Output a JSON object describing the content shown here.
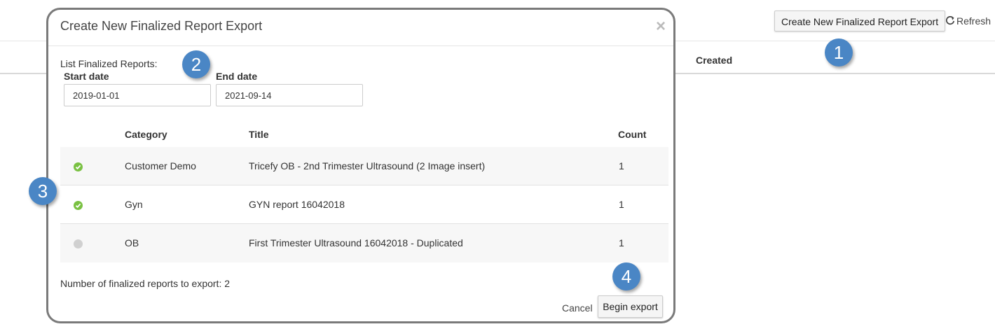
{
  "background": {
    "create_button_label": "Create New Finalized Report Export",
    "refresh_label": "Refresh",
    "created_header": "Created"
  },
  "modal": {
    "title": "Create New Finalized Report Export",
    "close_symbol": "×",
    "list_label": "List Finalized Reports:",
    "start_date_label": "Start date",
    "start_date_value": "2019-01-01",
    "end_date_label": "End date",
    "end_date_value": "2021-09-14",
    "columns": [
      "Category",
      "Title",
      "Count"
    ],
    "rows": [
      {
        "selected": true,
        "category": "Customer Demo",
        "title": "Tricefy OB - 2nd Trimester Ultrasound (2 Image insert)",
        "count": "1"
      },
      {
        "selected": true,
        "category": "Gyn",
        "title": "GYN report 16042018",
        "count": "1"
      },
      {
        "selected": false,
        "category": "OB",
        "title": "First Trimester Ultrasound 16042018 - Duplicated",
        "count": "1"
      }
    ],
    "export_count_text": "Number of finalized reports to export: 2",
    "cancel_label": "Cancel",
    "begin_label": "Begin export"
  },
  "badges": [
    "1",
    "2",
    "3",
    "4"
  ],
  "colors": {
    "badge": "#4a86c5",
    "check_green": "#7ac143",
    "unchecked_gray": "#d0d0d0",
    "modal_border": "#7a7a7a"
  }
}
